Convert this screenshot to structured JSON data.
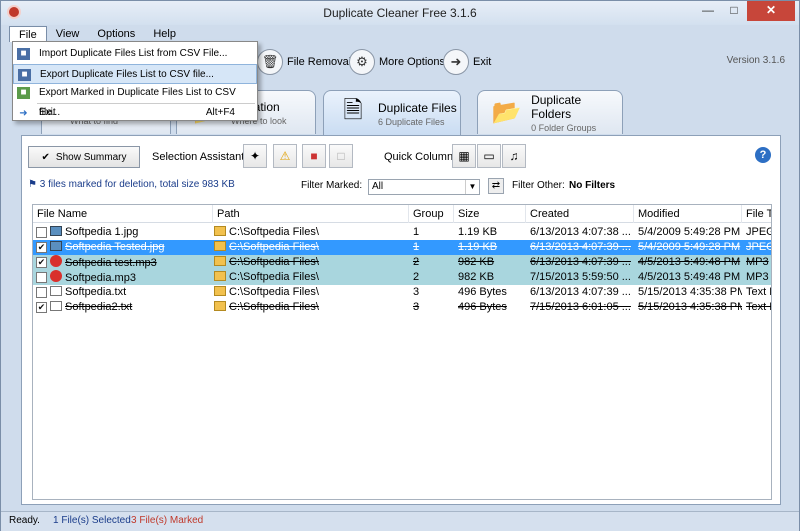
{
  "window": {
    "title": "Duplicate Cleaner Free 3.1.6",
    "version": "Version 3.1.6"
  },
  "menu": [
    {
      "label": "File"
    },
    {
      "label": "View"
    },
    {
      "label": "Options"
    },
    {
      "label": "Help"
    }
  ],
  "file_menu": {
    "items": [
      {
        "label": "Import Duplicate Files List from CSV File...",
        "shortcut": ""
      },
      {
        "label": "Export Duplicate Files List to CSV file...",
        "shortcut": ""
      },
      {
        "label": "Export Marked in Duplicate Files List to CSV file...",
        "shortcut": ""
      },
      {
        "label": "Exit",
        "shortcut": "Alt+F4"
      }
    ]
  },
  "toolbar": {
    "file_removal": "File Removal...",
    "more_options": "More Options...",
    "exit": "Exit"
  },
  "tabs": [
    {
      "title": "...",
      "sub": "What to find"
    },
    {
      "title": "...ocation",
      "sub": "Where to look"
    },
    {
      "title": "Duplicate Files",
      "sub": "6 Duplicate Files"
    },
    {
      "title": "Duplicate Folders",
      "sub": "0 Folder Groups"
    }
  ],
  "panel": {
    "show_summary": "Show Summary",
    "selection_assistant": "Selection Assistant",
    "quick_columns": "Quick Columns",
    "info": "3 files marked for deletion, total size 983 KB",
    "filter_marked_label": "Filter Marked:",
    "filter_marked_value": "All",
    "filter_other_label": "Filter Other:",
    "filter_other_value": "No Filters"
  },
  "grid": {
    "columns": [
      "File Name",
      "Path",
      "Group",
      "Size",
      "Created",
      "Modified",
      "File T"
    ],
    "rows": [
      {
        "name": "Softpedia 1.jpg",
        "path": "C:\\Softpedia Files\\",
        "group": "1",
        "size": "1.19 KB",
        "created": "6/13/2013 4:07:38 ...",
        "modified": "5/4/2009 5:49:28 PM",
        "type": "JPEG"
      },
      {
        "name": "Softpedia Tested.jpg",
        "path": "C:\\Softpedia Files\\",
        "group": "1",
        "size": "1.19 KB",
        "created": "6/13/2013 4:07:39 ...",
        "modified": "5/4/2009 5:49:28 PM",
        "type": "JPEG"
      },
      {
        "name": "Softpedia test.mp3",
        "path": "C:\\Softpedia Files\\",
        "group": "2",
        "size": "982 KB",
        "created": "6/13/2013 4:07:39 ...",
        "modified": "4/5/2013 5:49:48 PM",
        "type": "MP3"
      },
      {
        "name": "Softpedia.mp3",
        "path": "C:\\Softpedia Files\\",
        "group": "2",
        "size": "982 KB",
        "created": "7/15/2013 5:59:50 ...",
        "modified": "4/5/2013 5:49:48 PM",
        "type": "MP3"
      },
      {
        "name": "Softpedia.txt",
        "path": "C:\\Softpedia Files\\",
        "group": "3",
        "size": "496 Bytes",
        "created": "6/13/2013 4:07:39 ...",
        "modified": "5/15/2013 4:35:38 PM",
        "type": "Text D"
      },
      {
        "name": "Softpedia2.txt",
        "path": "C:\\Softpedia Files\\",
        "group": "3",
        "size": "496 Bytes",
        "created": "7/15/2013 6:01:05 ...",
        "modified": "5/15/2013 4:35:38 PM",
        "type": "Text D"
      }
    ]
  },
  "status": {
    "ready": "Ready.",
    "selected": "1 File(s) Selected",
    "marked": "3 File(s) Marked"
  }
}
